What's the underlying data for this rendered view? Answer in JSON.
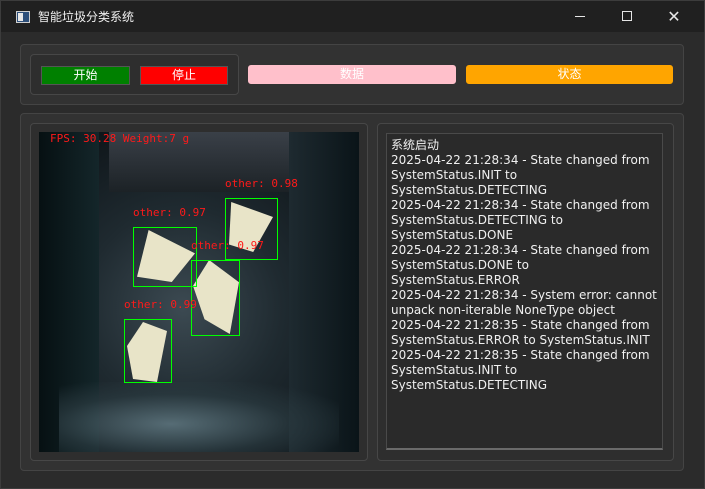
{
  "window": {
    "title": "智能垃圾分类系统",
    "minimize_icon": "minimize-icon",
    "maximize_icon": "maximize-icon",
    "close_icon": "close-icon"
  },
  "controls": {
    "start_label": "开始",
    "stop_label": "停止",
    "data_label": "数据",
    "status_label": "状态",
    "colors": {
      "start": "#008000",
      "stop": "#ff0000",
      "data": "#ffc0cb",
      "status": "#ffa500"
    }
  },
  "video": {
    "overlay_text": "FPS: 30.28  Weight:7 g",
    "detections": [
      {
        "label": "other: 0.98"
      },
      {
        "label": "other: 0.97"
      },
      {
        "label": "other: 0.97"
      },
      {
        "label": "other: 0.99"
      }
    ]
  },
  "log": {
    "lines": [
      "系统启动",
      "2025-04-22 21:28:34 - State changed from SystemStatus.INIT to SystemStatus.DETECTING",
      "2025-04-22 21:28:34 - State changed from SystemStatus.DETECTING to SystemStatus.DONE",
      "2025-04-22 21:28:34 - State changed from SystemStatus.DONE to SystemStatus.ERROR",
      "2025-04-22 21:28:34 - System error: cannot unpack non-iterable NoneType object",
      "2025-04-22 21:28:35 - State changed from SystemStatus.ERROR to SystemStatus.INIT",
      "2025-04-22 21:28:35 - State changed from SystemStatus.INIT to SystemStatus.DETECTING"
    ]
  }
}
